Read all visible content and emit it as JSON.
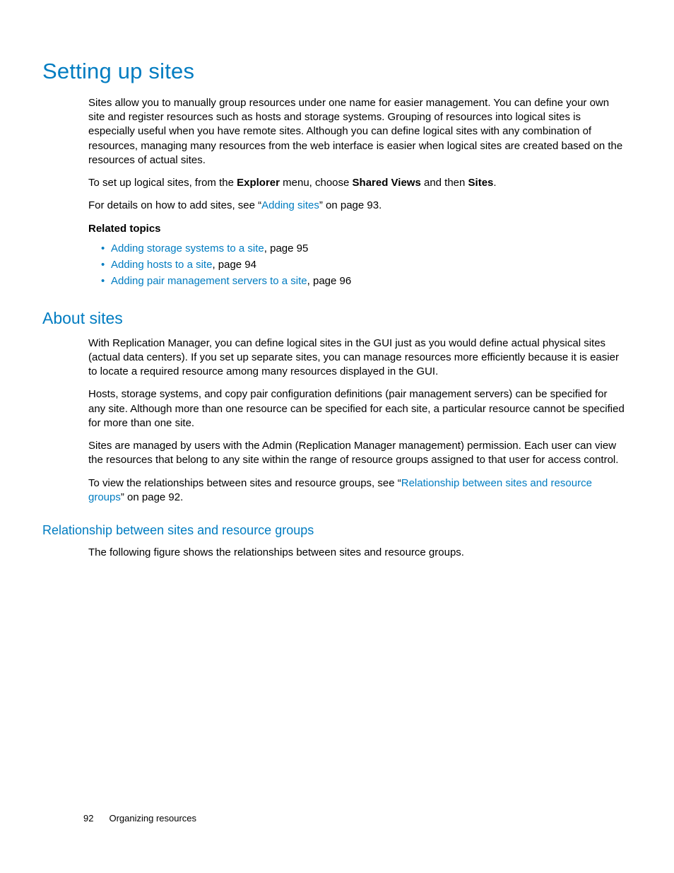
{
  "h1": "Setting up sites",
  "p1a": "Sites allow you to manually group resources under one name for easier management. You can define your own site and register resources such as hosts and storage systems. Grouping of resources into logical sites is especially useful when you have remote sites. Although you can define logical sites with any combination of resources, managing many resources from the web interface is easier when logical sites are created based on the resources of actual sites.",
  "p2": {
    "pre": "To set up logical sites, from the ",
    "b1": "Explorer",
    "mid1": " menu, choose ",
    "b2": "Shared Views",
    "mid2": " and then ",
    "b3": "Sites",
    "post": "."
  },
  "p3": {
    "pre": " For details on how to add sites, see “",
    "link": "Adding sites",
    "post": "” on page 93."
  },
  "related_heading": "Related topics",
  "related": [
    {
      "link": "Adding storage systems to a site",
      "rest": ", page 95"
    },
    {
      "link": "Adding hosts to a site",
      "rest": ", page 94"
    },
    {
      "link": "Adding pair management servers to a site",
      "rest": ", page 96"
    }
  ],
  "h2": "About sites",
  "about_p1": "With Replication Manager, you can define logical sites in the GUI just as you would define actual physical sites (actual data centers). If you set up separate sites, you can manage resources more efficiently because it is easier to locate a required resource among many resources displayed in the GUI.",
  "about_p2": "Hosts, storage systems, and copy pair configuration definitions (pair management servers) can be specified for any site. Although more than one resource can be specified for each site, a particular resource cannot be specified for more than one site.",
  "about_p3": "Sites are managed by users with the Admin (Replication Manager management) permission. Each user can view the resources that belong to any site within the range of resource groups assigned to that user for access control.",
  "about_p4": {
    "pre": "To view the relationships between sites and resource groups, see “",
    "link": "Relationship between sites and resource groups",
    "post": "” on page 92."
  },
  "h3": "Relationship between sites and resource groups",
  "rel_p1": "The following figure shows the relationships between sites and resource groups.",
  "footer": {
    "page": "92",
    "title": "Organizing resources"
  }
}
